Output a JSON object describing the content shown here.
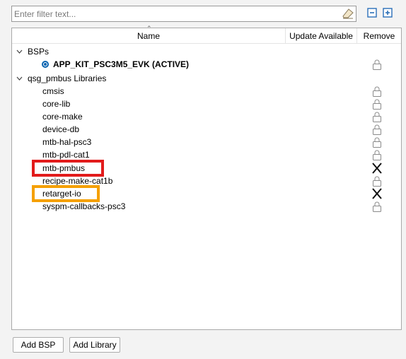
{
  "filter": {
    "placeholder": "Enter filter text...",
    "value": ""
  },
  "toolbar": {
    "collapse_icon": "collapse-all-icon",
    "expand_icon": "expand-all-icon"
  },
  "columns": {
    "name": "Name",
    "update": "Update Available",
    "remove": "Remove"
  },
  "tree": {
    "bsps": {
      "label": "BSPs",
      "items": [
        {
          "label": "APP_KIT_PSC3M5_EVK (ACTIVE)",
          "active": true,
          "remove": "lock-icon"
        }
      ]
    },
    "libs": {
      "label": "qsg_pmbus Libraries",
      "items": [
        {
          "label": "cmsis",
          "remove": "lock-icon"
        },
        {
          "label": "core-lib",
          "remove": "lock-icon"
        },
        {
          "label": "core-make",
          "remove": "lock-icon"
        },
        {
          "label": "device-db",
          "remove": "lock-icon"
        },
        {
          "label": "mtb-hal-psc3",
          "remove": "lock-icon"
        },
        {
          "label": "mtb-pdl-cat1",
          "remove": "lock-icon"
        },
        {
          "label": "mtb-pmbus",
          "remove": "delete-x-icon"
        },
        {
          "label": "recipe-make-cat1b",
          "remove": "lock-icon"
        },
        {
          "label": "retarget-io",
          "remove": "delete-x-icon"
        },
        {
          "label": "syspm-callbacks-psc3",
          "remove": "lock-icon"
        }
      ]
    }
  },
  "highlights": {
    "red": "#e21b1b",
    "orange": "#f5a000"
  },
  "buttons": {
    "add_bsp": "Add BSP",
    "add_library": "Add Library"
  }
}
